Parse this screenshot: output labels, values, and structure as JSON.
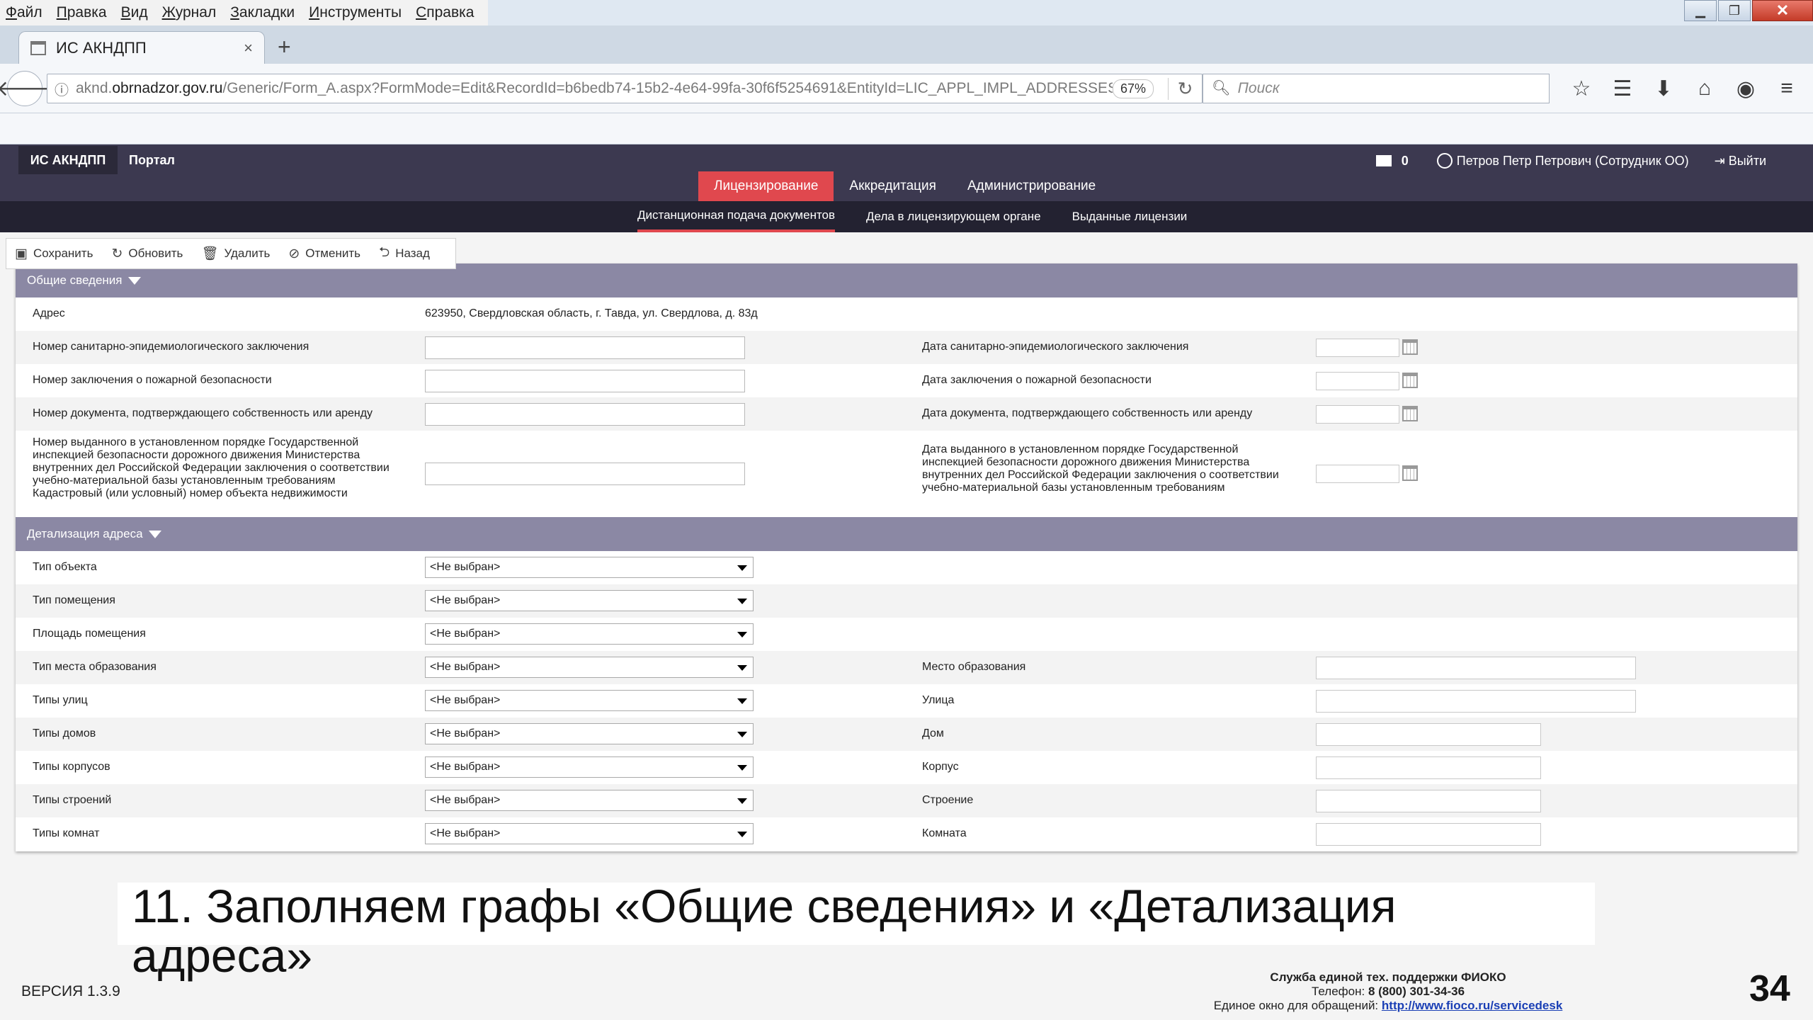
{
  "menubar": [
    "Файл",
    "Правка",
    "Вид",
    "Журнал",
    "Закладки",
    "Инструменты",
    "Справка"
  ],
  "tab": {
    "title": "ИС АКНДПП",
    "close": "×",
    "new": "+"
  },
  "address": {
    "host_pre": "aknd.",
    "host_main": "obrnadzor.gov.ru",
    "path": "/Generic/Form_A.aspx?FormMode=Edit&RecordId=b6bedb74-15b2-4e64-99fa-30f6f5254691&EntityId=LIC_APPL_IMPL_ADDRESSES_USE",
    "zoom": "67%"
  },
  "search": {
    "placeholder": "Поиск"
  },
  "header": {
    "brand": "ИС АКНДПП",
    "portal": "Портал",
    "messages": "0",
    "user": "Петров Петр Петрович (Сотрудник ОО)",
    "logout": "Выйти"
  },
  "main_tabs": [
    "Лицензирование",
    "Аккредитация",
    "Администрирование"
  ],
  "sub_tabs": [
    "Дистанционная подача документов",
    "Дела в лицензирующем органе",
    "Выданные лицензии"
  ],
  "toolbar": {
    "save": "Сохранить",
    "refresh": "Обновить",
    "delete": "Удалить",
    "cancel": "Отменить",
    "back": "Назад"
  },
  "general": {
    "title": "Общие сведения",
    "address_label": "Адрес",
    "address_value": "623950, Свердловская область, г. Тавда, ул. Свердлова, д. 83д",
    "rows": [
      {
        "left": "Номер санитарно-эпидемиологического заключения",
        "right": "Дата санитарно-эпидемиологического заключения"
      },
      {
        "left": "Номер заключения о пожарной безопасности",
        "right": "Дата заключения о пожарной безопасности"
      },
      {
        "left": "Номер документа, подтверждающего собственность или аренду",
        "right": "Дата документа, подтверждающего собственность или аренду"
      },
      {
        "left": "Номер выданного в установленном порядке Государственной инспекцией безопасности дорожного движения Министерства внутренних дел Российской Федерации заключения о соответствии учебно-материальной базы установленным требованиям Кадастровый (или условный) номер объекта недвижимости",
        "right": "Дата выданного в установленном порядке Государственной инспекцией безопасности дорожного движения Министерства внутренних дел Российской Федерации заключения о соответствии учебно-материальной базы установленным требованиям"
      }
    ]
  },
  "detail": {
    "title": "Детализация адреса",
    "select_value": "<Не выбран>",
    "rows": [
      {
        "left": "Тип объекта",
        "right": ""
      },
      {
        "left": "Тип помещения",
        "right": ""
      },
      {
        "left": "Площадь помещения",
        "right": ""
      },
      {
        "left": "Тип места образования",
        "right": "Место образования"
      },
      {
        "left": "Типы улиц",
        "right": "Улица"
      },
      {
        "left": "Типы домов",
        "right": "Дом"
      },
      {
        "left": "Типы корпусов",
        "right": "Корпус"
      },
      {
        "left": "Типы строений",
        "right": "Строение"
      },
      {
        "left": "Типы комнат",
        "right": "Комната"
      }
    ]
  },
  "slide": {
    "caption": "11. Заполняем графы «Общие сведения» и «Детализация адреса»",
    "version": "ВЕРСИЯ 1.3.9",
    "support_title": "Служба единой тех. поддержки ФИОКО",
    "support_phone_label": "Телефон:",
    "support_phone": "8 (800) 301-34-36",
    "support_window": "Единое окно для обращений:",
    "support_url": "http://www.fioco.ru/servicedesk",
    "page_number": "34"
  },
  "colors": {
    "header_bg": "#3c3950",
    "accent": "#e0484e",
    "section_bg": "#8b88a4"
  }
}
